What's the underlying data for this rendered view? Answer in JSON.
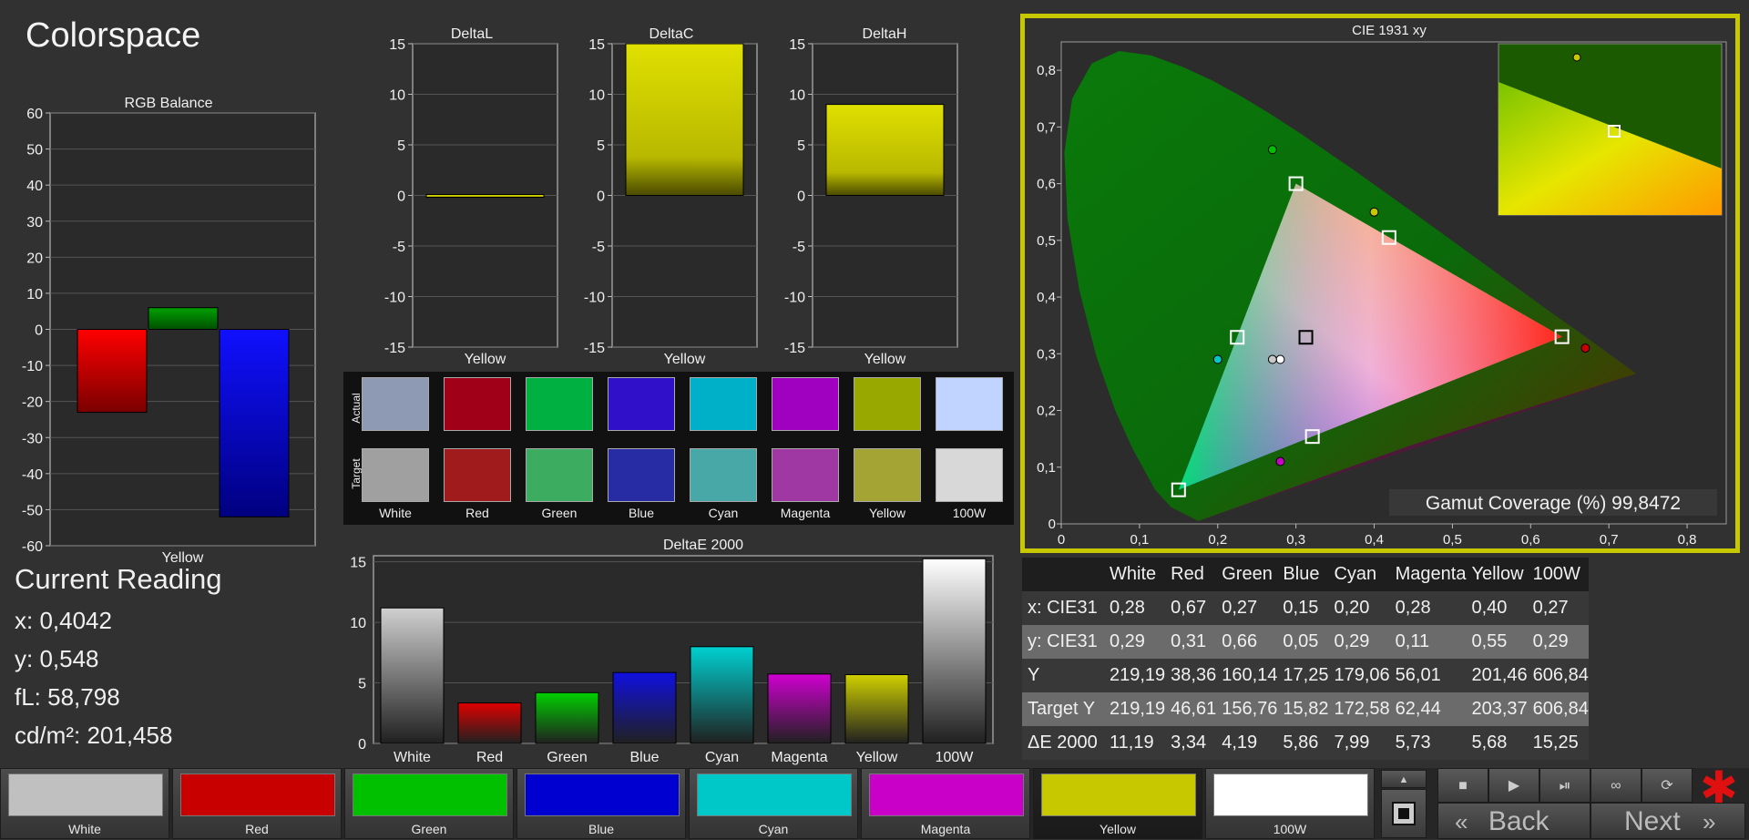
{
  "title": "Colorspace",
  "current_reading": {
    "heading": "Current Reading",
    "x": "x: 0,4042",
    "y": "y: 0,548",
    "fl": "fL: 58,798",
    "cdm2": "cd/m²: 201,458"
  },
  "colors": {
    "white": "#c8c8c8",
    "red": "#c80000",
    "green": "#00c000",
    "blue": "#0000d0",
    "cyan": "#00c8c8",
    "magenta": "#c800c8",
    "yellow": "#c8c800",
    "w100": "#ffffff",
    "accent": "#c8c800"
  },
  "chart_data": [
    {
      "type": "bar",
      "title": "RGB Balance",
      "categories": [
        "Yellow"
      ],
      "series": [
        {
          "values": [
            -23
          ]
        },
        {
          "values": [
            6
          ]
        },
        {
          "values": [
            -52
          ]
        }
      ],
      "series_colors": [
        "#e00000",
        "#00a000",
        "#1010f0"
      ],
      "ylim": [
        -60,
        60
      ],
      "yticks": [
        60,
        50,
        40,
        30,
        20,
        10,
        0,
        -10,
        -20,
        -30,
        -40,
        -50,
        -60
      ],
      "xlabel": "Yellow"
    },
    {
      "type": "bar",
      "title": "DeltaL",
      "categories": [
        "Yellow"
      ],
      "values": [
        0
      ],
      "ylim": [
        -15,
        15
      ],
      "yticks": [
        15,
        10,
        5,
        0,
        -5,
        -10,
        -15
      ],
      "xlabel": "Yellow"
    },
    {
      "type": "bar",
      "title": "DeltaC",
      "categories": [
        "Yellow"
      ],
      "values": [
        15
      ],
      "ylim": [
        -15,
        15
      ],
      "yticks": [
        15,
        10,
        5,
        0,
        -5,
        -10,
        -15
      ],
      "xlabel": "Yellow"
    },
    {
      "type": "bar",
      "title": "DeltaH",
      "categories": [
        "Yellow"
      ],
      "values": [
        9
      ],
      "ylim": [
        -15,
        15
      ],
      "yticks": [
        15,
        10,
        5,
        0,
        -5,
        -10,
        -15
      ],
      "xlabel": "Yellow"
    },
    {
      "type": "bar",
      "title": "DeltaE 2000",
      "categories": [
        "White",
        "Red",
        "Green",
        "Blue",
        "Cyan",
        "Magenta",
        "Yellow",
        "100W"
      ],
      "values": [
        11.19,
        3.34,
        4.19,
        5.86,
        7.99,
        5.73,
        5.68,
        15.25
      ],
      "bar_colors": [
        "#d0d0d0",
        "#e00000",
        "#00d000",
        "#1010e0",
        "#00d0d0",
        "#d000d0",
        "#d0d000",
        "#ffffff"
      ],
      "ylim": [
        0,
        15.5
      ],
      "yticks": [
        15,
        10,
        5,
        0
      ]
    },
    {
      "type": "scatter",
      "title": "CIE 1931 xy",
      "xlim": [
        0,
        0.85
      ],
      "ylim": [
        0,
        0.85
      ],
      "xticks": [
        "0",
        "0,1",
        "0,2",
        "0,3",
        "0,4",
        "0,5",
        "0,6",
        "0,7",
        "0,8"
      ],
      "yticks": [
        "0",
        "0,1",
        "0,2",
        "0,3",
        "0,4",
        "0,5",
        "0,6",
        "0,7",
        "0,8"
      ],
      "target_points": [
        {
          "x": 0.64,
          "y": 0.33
        },
        {
          "x": 0.3,
          "y": 0.6
        },
        {
          "x": 0.15,
          "y": 0.06
        },
        {
          "x": 0.225,
          "y": 0.329
        },
        {
          "x": 0.321,
          "y": 0.154
        },
        {
          "x": 0.419,
          "y": 0.505
        },
        {
          "x": 0.3127,
          "y": 0.329
        }
      ],
      "measured_points": [
        {
          "x": 0.67,
          "y": 0.31
        },
        {
          "x": 0.27,
          "y": 0.66
        },
        {
          "x": 0.2,
          "y": 0.29
        },
        {
          "x": 0.28,
          "y": 0.11
        },
        {
          "x": 0.4,
          "y": 0.55
        },
        {
          "x": 0.28,
          "y": 0.29
        },
        {
          "x": 0.27,
          "y": 0.29
        }
      ],
      "gamut_coverage_label": "Gamut Coverage (%) 99,8472"
    }
  ],
  "swatches": {
    "row_labels": [
      "Actual",
      "Target"
    ],
    "labels": [
      "White",
      "Red",
      "Green",
      "Blue",
      "Cyan",
      "Magenta",
      "Yellow",
      "100W"
    ],
    "actual": [
      "#8e9ab4",
      "#a00018",
      "#00b040",
      "#3010c8",
      "#00b0c8",
      "#a000c0",
      "#98a800",
      "#c0d4ff"
    ],
    "target": [
      "#a0a0a0",
      "#a01c1c",
      "#3cac60",
      "#282ca4",
      "#48a8a8",
      "#a038a4",
      "#a4a434",
      "#d8d8d8"
    ]
  },
  "table": {
    "headers": [
      "",
      "White",
      "Red",
      "Green",
      "Blue",
      "Cyan",
      "Magenta",
      "Yellow",
      "100W"
    ],
    "rows": [
      [
        "x: CIE31",
        "0,28",
        "0,67",
        "0,27",
        "0,15",
        "0,20",
        "0,28",
        "0,40",
        "0,27"
      ],
      [
        "y: CIE31",
        "0,29",
        "0,31",
        "0,66",
        "0,05",
        "0,29",
        "0,11",
        "0,55",
        "0,29"
      ],
      [
        "Y",
        "219,19",
        "38,36",
        "160,14",
        "17,25",
        "179,06",
        "56,01",
        "201,46",
        "606,84"
      ],
      [
        "Target Y",
        "219,19",
        "46,61",
        "156,76",
        "15,82",
        "172,58",
        "62,44",
        "203,37",
        "606,84"
      ],
      [
        "ΔE 2000",
        "11,19",
        "3,34",
        "4,19",
        "5,86",
        "7,99",
        "5,73",
        "5,68",
        "15,25"
      ]
    ]
  },
  "bottom_buttons": [
    {
      "label": "White",
      "color": "#c0c0c0"
    },
    {
      "label": "Red",
      "color": "#c80000"
    },
    {
      "label": "Green",
      "color": "#00c000"
    },
    {
      "label": "Blue",
      "color": "#0000d0"
    },
    {
      "label": "Cyan",
      "color": "#00c8c8"
    },
    {
      "label": "Magenta",
      "color": "#c800c8"
    },
    {
      "label": "Yellow",
      "color": "#c8c800"
    },
    {
      "label": "100W",
      "color": "#ffffff"
    }
  ],
  "nav": {
    "back_label": "Back",
    "next_label": "Next",
    "back_icon": "«",
    "next_icon": "»",
    "star_icon": "✱"
  },
  "toolbar_icons": [
    "stop-icon",
    "play-icon",
    "step-icon",
    "loop-icon",
    "refresh-icon"
  ]
}
